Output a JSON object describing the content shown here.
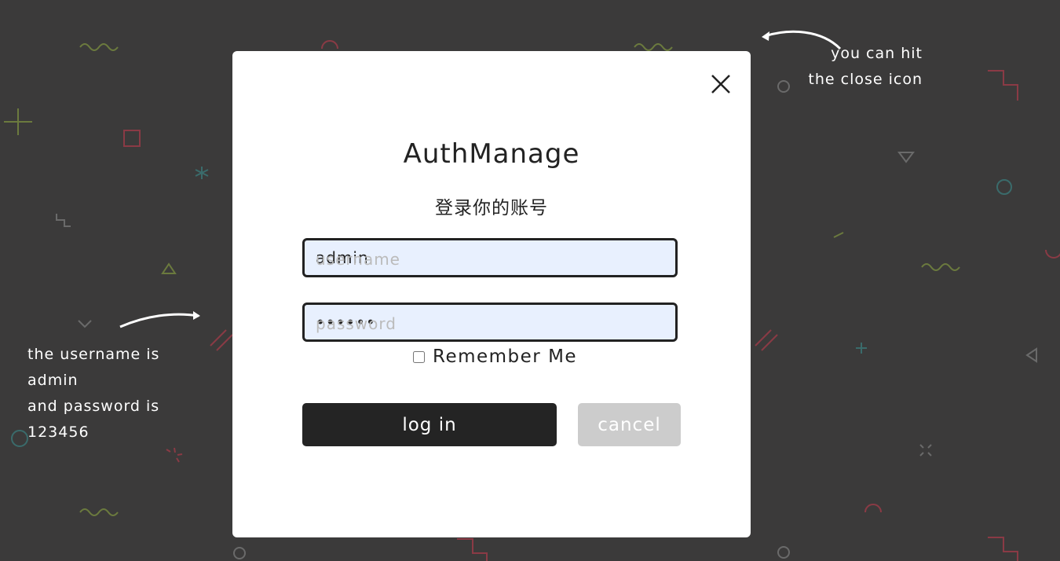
{
  "colors": {
    "background": "#3b3a3a",
    "modal": "#ffffff",
    "primary_button": "#242424",
    "cancel_button": "#cccccc",
    "input_fill": "#e8f0fe"
  },
  "hints": {
    "left_lines": [
      "the username is",
      "admin",
      "and password is",
      "123456"
    ],
    "right_lines": [
      "you can hit",
      "the close icon"
    ]
  },
  "modal": {
    "close_icon": "close-icon",
    "title": "AuthManage",
    "subtitle": "登录你的账号",
    "username": {
      "value": "admin",
      "placeholder": "username"
    },
    "password": {
      "value": "123456",
      "placeholder": "password",
      "masked": "••••••"
    },
    "remember_label": "Remember Me",
    "login_label": "log in",
    "cancel_label": "cancel"
  }
}
